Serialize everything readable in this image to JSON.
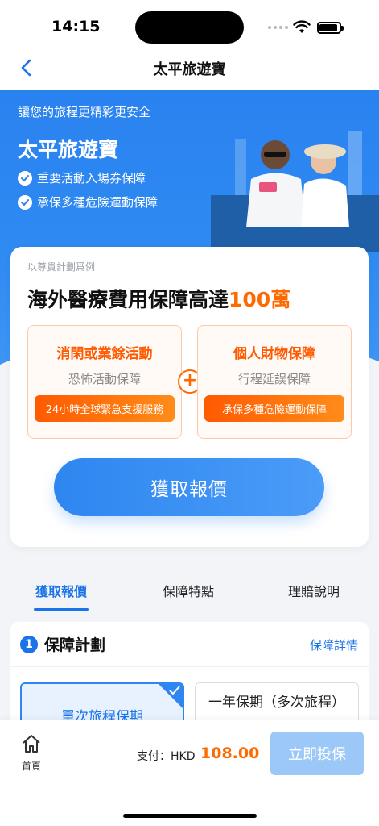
{
  "status": {
    "time": "14:15"
  },
  "nav": {
    "title": "太平旅遊寶"
  },
  "hero": {
    "tagline": "讓您的旅程更精彩更安全",
    "title": "太平旅遊寶",
    "features": [
      "重要活動入場券保障",
      "承保多種危險運動保障"
    ]
  },
  "card": {
    "note": "以尊貴計劃爲例",
    "headline_prefix": "海外醫療費用保障高達",
    "headline_highlight": "100萬",
    "boxes": [
      {
        "title": "消閑或業餘活動",
        "sub": "恐怖活動保障",
        "tag": "24小時全球緊急支援服務"
      },
      {
        "title": "個人財物保障",
        "sub": "行程延誤保障",
        "tag": "承保多種危險運動保障"
      }
    ],
    "plus": "+",
    "cta": "獲取報價"
  },
  "tabs": [
    "獲取報價",
    "保障特點",
    "理賠說明"
  ],
  "plan": {
    "number": "1",
    "title": "保障計劃",
    "detail_link": "保障詳情",
    "options": [
      "單次旅程保期",
      "一年保期（多次旅程）"
    ]
  },
  "bottom": {
    "home": "首頁",
    "pay_label": "支付：HKD",
    "pay_amount": "108.00",
    "buy": "立即投保"
  },
  "colors": {
    "primary": "#1a73e8",
    "accent": "#ff6a00",
    "hero": "#2a82f0"
  }
}
